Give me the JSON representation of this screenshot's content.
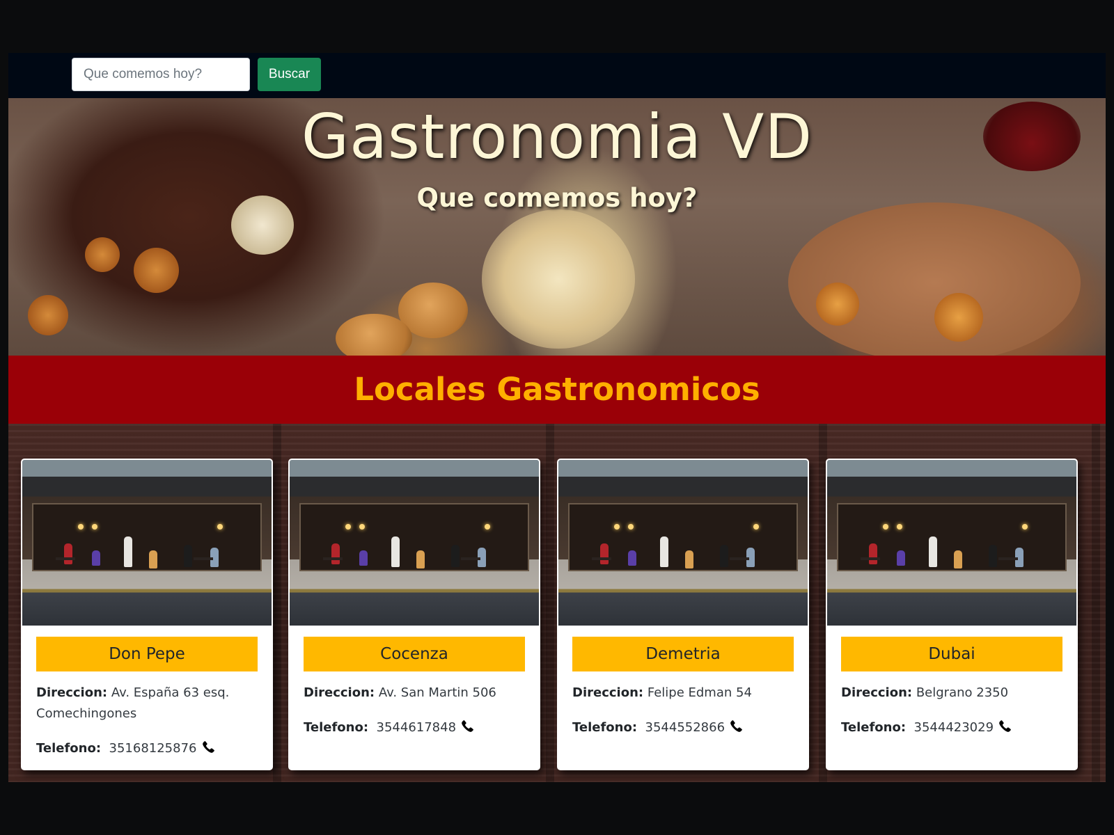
{
  "navbar": {
    "search_placeholder": "Que comemos hoy?",
    "search_value": "",
    "search_button": "Buscar"
  },
  "hero": {
    "title": "Gastronomia VD",
    "subtitle": "Que comemos hoy?"
  },
  "section": {
    "title": "Locales Gastronomicos"
  },
  "cards": [
    {
      "name": "Don Pepe",
      "address_label": "Direccion:",
      "address": "Av. España 63 esq. Comechingones",
      "phone_label": "Telefono:",
      "phone": "35168125876"
    },
    {
      "name": "Cocenza",
      "address_label": "Direccion:",
      "address": "Av. San Martin 506",
      "phone_label": "Telefono:",
      "phone": "3544617848"
    },
    {
      "name": "Demetria",
      "address_label": "Direccion:",
      "address": "Felipe Edman 54",
      "phone_label": "Telefono:",
      "phone": "3544552866"
    },
    {
      "name": "Dubai",
      "address_label": "Direccion:",
      "address": "Belgrano 2350",
      "phone_label": "Telefono:",
      "phone": "3544423029"
    }
  ],
  "icons": {
    "phone": "phone-icon"
  },
  "colors": {
    "navbar_bg": "#000814",
    "button_green": "#198754",
    "section_red": "#9a0007",
    "section_title": "#ffb000",
    "card_title_bg": "#ffb800"
  }
}
